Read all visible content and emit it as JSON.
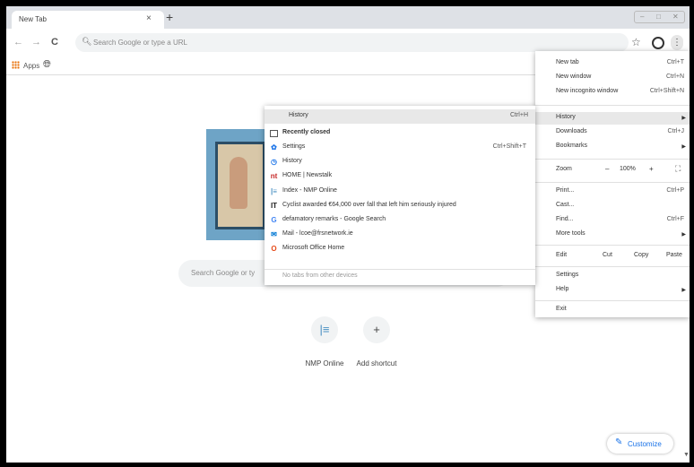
{
  "tab": {
    "title": "New Tab",
    "close": "×",
    "new_tab": "+"
  },
  "window_controls": [
    "–",
    "□",
    "✕"
  ],
  "toolbar": {
    "back": "←",
    "forward": "→",
    "reload": "C",
    "omnibox_icon": "search-icon",
    "omnibox_placeholder": "Search Google or type a URL",
    "star": "☆",
    "menu_dots": "⋮"
  },
  "bookmarks": {
    "apps_label": "Apps"
  },
  "ntp": {
    "search_placeholder": "Search Google or ty",
    "shortcuts": [
      {
        "label": "NMP Online",
        "icon": "|≡"
      },
      {
        "label": "Add shortcut",
        "icon": "+"
      }
    ],
    "customize_label": "Customize",
    "customize_icon": "pencil-icon"
  },
  "main_menu": {
    "new_tab": {
      "label": "New tab",
      "shortcut": "Ctrl+T"
    },
    "new_window": {
      "label": "New window",
      "shortcut": "Ctrl+N"
    },
    "new_incognito": {
      "label": "New incognito window",
      "shortcut": "Ctrl+Shift+N"
    },
    "history": {
      "label": "History"
    },
    "downloads": {
      "label": "Downloads",
      "shortcut": "Ctrl+J"
    },
    "bookmarks": {
      "label": "Bookmarks"
    },
    "zoom": {
      "label": "Zoom",
      "minus": "–",
      "value": "100%",
      "plus": "+",
      "fullscreen": "⛶"
    },
    "print": {
      "label": "Print...",
      "shortcut": "Ctrl+P"
    },
    "cast": {
      "label": "Cast..."
    },
    "find": {
      "label": "Find...",
      "shortcut": "Ctrl+F"
    },
    "more_tools": {
      "label": "More tools"
    },
    "edit": {
      "label": "Edit",
      "cut": "Cut",
      "copy": "Copy",
      "paste": "Paste"
    },
    "settings": {
      "label": "Settings"
    },
    "help": {
      "label": "Help"
    },
    "exit": {
      "label": "Exit"
    }
  },
  "history_menu": {
    "header": {
      "label": "History",
      "shortcut": "Ctrl+H"
    },
    "recently_closed": "Recently closed",
    "items": [
      {
        "label": "Settings",
        "shortcut": "Ctrl+Shift+T",
        "icon": "✿",
        "color": "#1a73e8"
      },
      {
        "label": "History",
        "shortcut": "",
        "icon": "◷",
        "color": "#1a73e8"
      },
      {
        "label": "HOME | Newstalk",
        "shortcut": "",
        "icon": "nt",
        "color": "#c62828"
      },
      {
        "label": "Index - NMP Online",
        "shortcut": "",
        "icon": "|≡",
        "color": "#4a90c2"
      },
      {
        "label": "Cyclist awarded €64,000 over fall that left him seriously injured",
        "shortcut": "",
        "icon": "IT",
        "color": "#222222"
      },
      {
        "label": "defamatory remarks - Google Search",
        "shortcut": "",
        "icon": "G",
        "color": "#4285f4"
      },
      {
        "label": "Mail - lcoe@frsnetwork.ie",
        "shortcut": "",
        "icon": "✉",
        "color": "#0078d4"
      },
      {
        "label": "Microsoft Office Home",
        "shortcut": "",
        "icon": "O",
        "color": "#e64a19"
      }
    ],
    "no_tabs": "No tabs from other devices"
  }
}
